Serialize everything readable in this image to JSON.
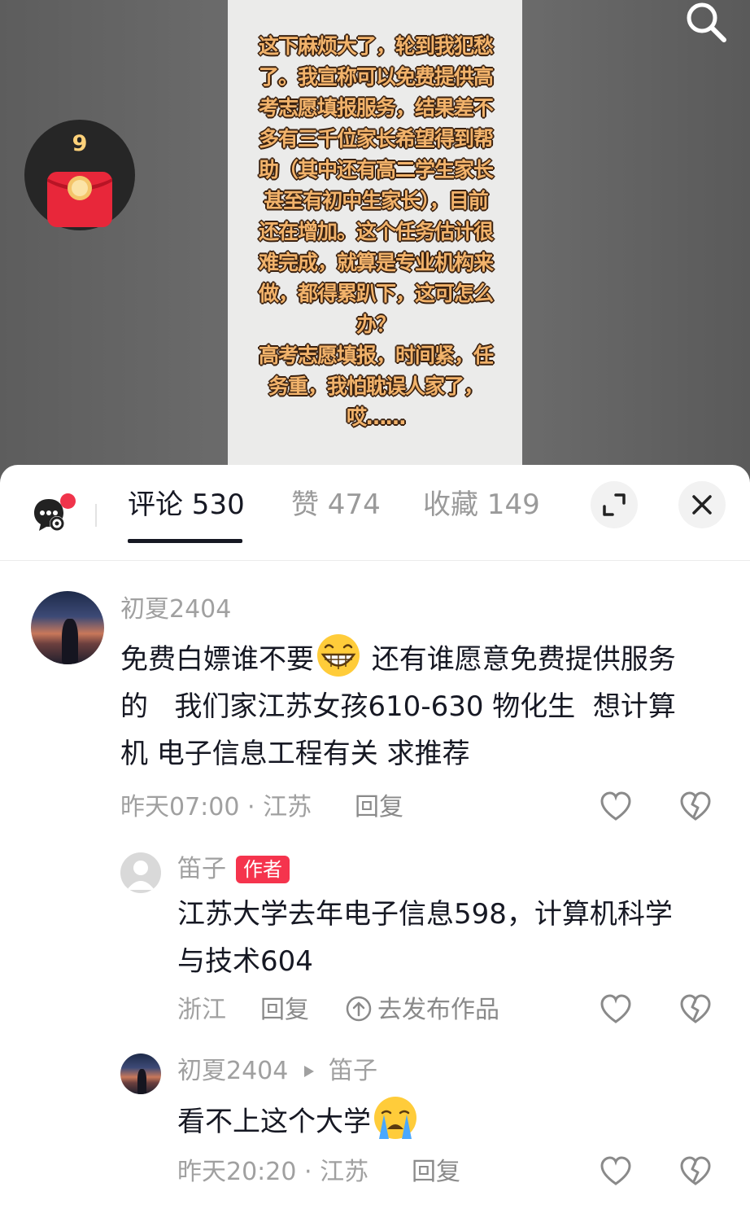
{
  "video": {
    "note_lines": [
      "这下麻烦大了，轮到我犯愁",
      "了。我宣称可以免费提供高",
      "考志愿填报服务，结果差不",
      "多有三千位家长希望得到帮",
      "助（其中还有高二学生家长",
      "甚至有初中生家长），目前",
      "还在增加。这个任务估计很",
      "难完成，就算是专业机构来",
      "做，都得累趴下，这可怎么",
      "办？",
      "高考志愿填报，时间紧，任",
      "务重，我怕耽误人家了，",
      "哎……"
    ],
    "red_packet_count": "9",
    "search_icon": "search-icon"
  },
  "tabs": {
    "comments": "评论 530",
    "likes": "赞 474",
    "favorites": "收藏 149",
    "active": "comments"
  },
  "comments": [
    {
      "user": "初夏2404",
      "text_line1": "免费白嫖谁不要",
      "text_line1b": "还有谁愿意免费提供服务",
      "text_line2": "的   我们家江苏女孩610-630 物化生  想计算",
      "text_line3": "机 电子信息工程有关 求推荐",
      "time": "昨天07:00",
      "location": "江苏",
      "reply_label": "回复"
    },
    {
      "user": "笛子",
      "badge": "作者",
      "text_line1": "江苏大学去年电子信息598，计算机科学",
      "text_line2": "与技术604",
      "location": "浙江",
      "reply_label": "回复",
      "publish_label": "去发布作品"
    },
    {
      "user": "初夏2404",
      "reply_to": "笛子",
      "text": "看不上这个大学",
      "time": "昨天20:20",
      "location": "江苏",
      "reply_label": "回复"
    }
  ],
  "colors": {
    "accent_red": "#f5344d",
    "text_primary": "#161823",
    "text_secondary": "#a0a0a0"
  }
}
